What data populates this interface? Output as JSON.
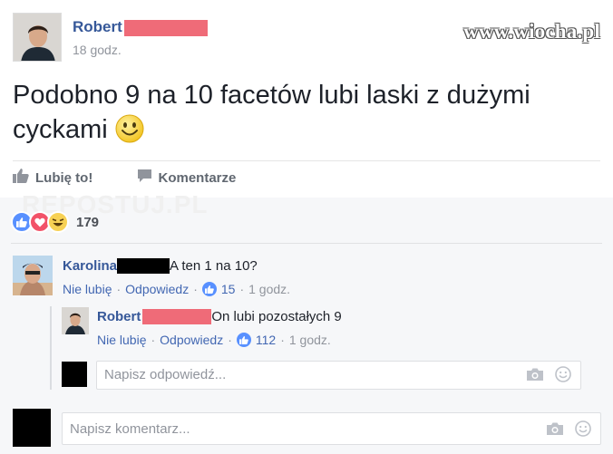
{
  "watermark": "www.wiocha.pl",
  "repost_watermark": "REPOSTUJ.PL",
  "post": {
    "author": "Robert",
    "time": "18 godz.",
    "text": "Podobno 9 na 10 facetów lubi laski z dużymi cyckami"
  },
  "actions": {
    "like_label": "Lubię to!",
    "comment_label": "Komentarze"
  },
  "reactions": {
    "count": "179",
    "types": [
      "like",
      "love",
      "haha"
    ]
  },
  "comments": [
    {
      "author": "Karolina",
      "text": "A ten 1 na 10?",
      "unlike": "Nie lubię",
      "reply": "Odpowiedz",
      "likes": "15",
      "time": "1 godz.",
      "replies": [
        {
          "author": "Robert",
          "text": "On lubi pozostałych 9",
          "unlike": "Nie lubię",
          "reply": "Odpowiedz",
          "likes": "112",
          "time": "1 godz."
        }
      ]
    }
  ],
  "reply_input": {
    "placeholder": "Napisz odpowiedź..."
  },
  "comment_input": {
    "placeholder": "Napisz komentarz..."
  },
  "colors": {
    "link": "#365899",
    "meta_link": "#4267b2",
    "muted": "#90949c",
    "redaction_pink": "#ef6b78",
    "redaction_black": "#000000",
    "like_blue": "#5890ff",
    "love_red": "#f25268",
    "haha_yellow": "#f7d154"
  },
  "icons": [
    "thumbs-up-icon",
    "comment-icon",
    "like-reaction-icon",
    "love-reaction-icon",
    "haha-reaction-icon",
    "camera-icon",
    "emoji-icon",
    "smiley-emoji"
  ]
}
